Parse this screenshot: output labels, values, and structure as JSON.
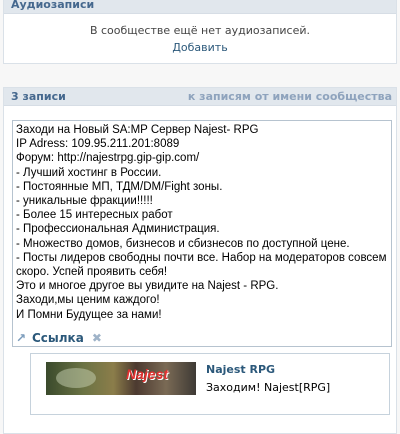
{
  "audio": {
    "title": "Аудиозаписи",
    "empty_text": "В сообществе ещё нет аудиозаписей.",
    "add_label": "Добавить"
  },
  "wall": {
    "count_label": "3 записи",
    "community_posts_link": "к записям от имени сообщества",
    "post_text": "Заходи на Новый SA:MP Сервер Najest- RPG\nIP Adress: 109.95.211.201:8089\nФорум: http://najestrpg.gip-gip.com/\n- Лучший хостинг в России.\n- Постоянные МП, ТДМ/DM/Fight зоны.\n- уникальные фракции!!!!!\n- Более 15 интересных работ\n- Профессиональная Администрация.\n- Множество домов, бизнесов и сбизнесов по доступной цене.\n- Посты лидеров свободны почти все. Набор на модераторов совсем скоро. Успей проявить себя!\nЭто и многое другое вы увидите на Najest - RPG.\nЗаходи,мы ценим каждого!\nИ Помни Будущее за нами!",
    "attachment": {
      "label": "Ссылка",
      "pin_icon": "paperclip-icon",
      "close_icon": "close-icon",
      "title": "Najest RPG",
      "description": "Заходим! Najest[RPG]",
      "thumb_logo": "Najest"
    }
  }
}
